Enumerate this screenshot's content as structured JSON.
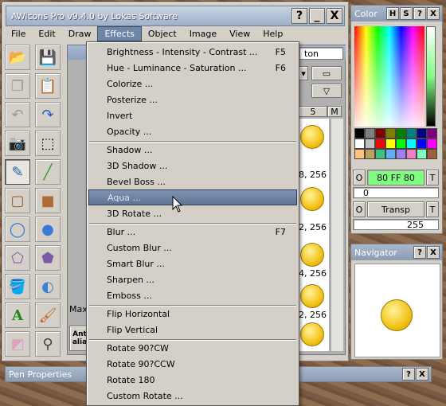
{
  "app": {
    "title": "AWicons Pro v9.4.0 by Lokas Software",
    "help_btn": "?",
    "min_btn": "_",
    "close_btn": "X"
  },
  "menubar": [
    "File",
    "Edit",
    "Draw",
    "Effects",
    "Object",
    "Image",
    "View",
    "Help"
  ],
  "effects_menu": {
    "group1": [
      {
        "label": "Brightness - Intensity - Contrast ...",
        "shortcut": "F5"
      },
      {
        "label": "Hue - Luminance - Saturation ...",
        "shortcut": "F6"
      },
      {
        "label": "Colorize ...",
        "shortcut": ""
      },
      {
        "label": "Posterize ...",
        "shortcut": ""
      },
      {
        "label": "Invert",
        "shortcut": ""
      },
      {
        "label": "Opacity ...",
        "shortcut": ""
      }
    ],
    "group2": [
      {
        "label": "Shadow ...",
        "shortcut": ""
      },
      {
        "label": "3D Shadow ...",
        "shortcut": ""
      },
      {
        "label": "Bevel Boss ...",
        "shortcut": ""
      },
      {
        "label": "Aqua ...",
        "shortcut": ""
      },
      {
        "label": "3D Rotate ...",
        "shortcut": ""
      }
    ],
    "group3": [
      {
        "label": "Blur ...",
        "shortcut": "F7"
      },
      {
        "label": "Custom Blur ...",
        "shortcut": ""
      },
      {
        "label": "Smart Blur ...",
        "shortcut": ""
      },
      {
        "label": "Sharpen ...",
        "shortcut": ""
      },
      {
        "label": "Emboss ...",
        "shortcut": ""
      }
    ],
    "group4": [
      {
        "label": "Flip Horizontal",
        "shortcut": ""
      },
      {
        "label": "Flip Vertical",
        "shortcut": ""
      }
    ],
    "group5": [
      {
        "label": "Rotate 90?CW",
        "shortcut": ""
      },
      {
        "label": "Rotate 90?CCW",
        "shortcut": ""
      },
      {
        "label": "Rotate 180",
        "shortcut": ""
      },
      {
        "label": "Custom Rotate ...",
        "shortcut": ""
      }
    ]
  },
  "partial": {
    "ton": "ton",
    "five": "5",
    "m": "M",
    "sizes": [
      "8, 256",
      "2, 256",
      "4, 256",
      "2, 256"
    ],
    "max": "Max",
    "anti1": "Ant",
    "anti2": "alia"
  },
  "color_panel": {
    "title": "Color",
    "btn_h": "H",
    "btn_s": "S",
    "btn_help": "?",
    "btn_x": "X",
    "o1": "O",
    "hex": "80 FF 80",
    "t1": "T",
    "zero": "0",
    "o2": "O",
    "transp": "Transp",
    "t2": "T",
    "alpha": "255"
  },
  "navigator": {
    "title": "Navigator",
    "help": "?",
    "close": "X"
  },
  "pen_properties": {
    "title": "Pen Properties",
    "help": "?",
    "close": "X"
  },
  "colors": {
    "accent_green": "#80ff80",
    "menu_highlight": "#6e86a7"
  }
}
